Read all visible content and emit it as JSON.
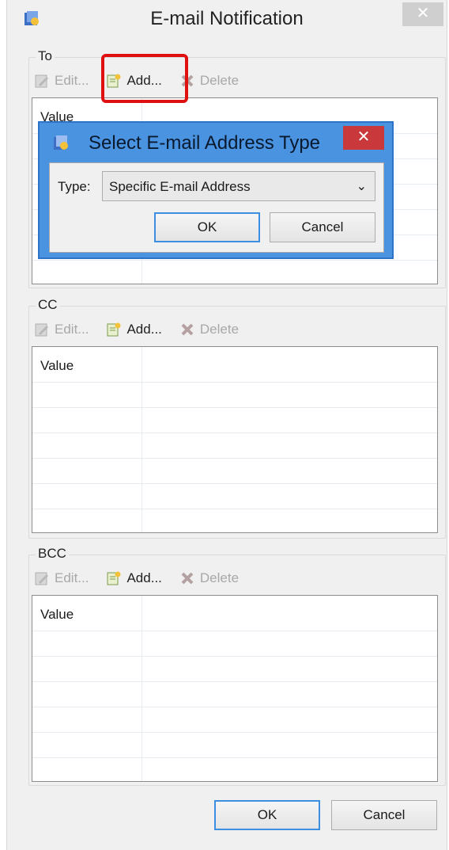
{
  "window": {
    "title": "E-mail Notification",
    "close_glyph": "✕"
  },
  "groups": {
    "to": {
      "label": "To"
    },
    "cc": {
      "label": "CC"
    },
    "bcc": {
      "label": "BCC"
    }
  },
  "toolbar": {
    "edit": "Edit...",
    "add": "Add...",
    "delete": "Delete"
  },
  "table": {
    "column_header": "Value"
  },
  "dialog": {
    "title": "Select E-mail Address Type",
    "close_glyph": "✕",
    "type_label": "Type:",
    "type_value": "Specific E-mail Address",
    "ok": "OK",
    "cancel": "Cancel"
  },
  "footer": {
    "ok": "OK",
    "cancel": "Cancel"
  },
  "colors": {
    "dialog_frame": "#4a93e0",
    "dialog_close": "#c9383a",
    "highlight": "#e01010"
  }
}
